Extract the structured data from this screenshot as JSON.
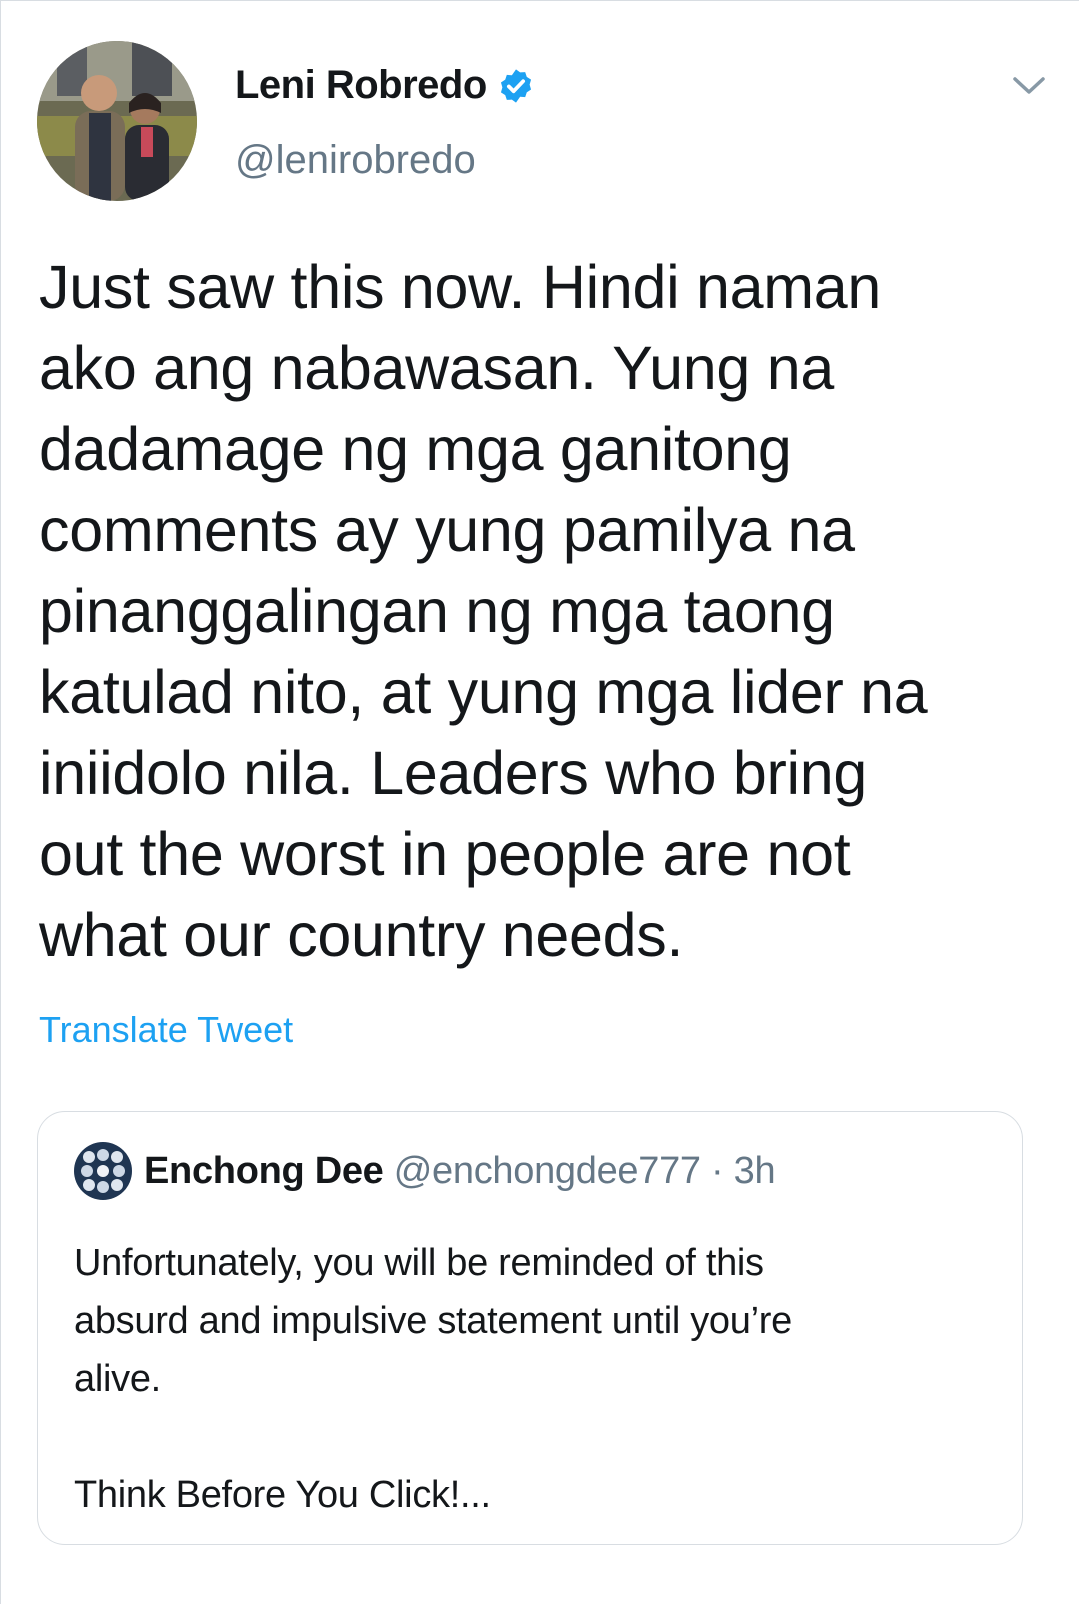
{
  "author": {
    "name": "Leni Robredo",
    "handle": "@lenirobredo",
    "verified": true,
    "avatar": "profile-photo-icon"
  },
  "tweet": {
    "lines": [
      "Just saw this now. Hindi naman",
      "ako ang nabawasan. Yung na",
      "dadamage ng mga ganitong",
      "comments ay yung pamilya na",
      "pinanggalingan ng mga taong",
      "katulad nito,  at yung mga lider na",
      "iniidolo nila. Leaders who bring",
      "out the worst in people are not",
      "what our country needs."
    ],
    "translate_label": "Translate Tweet"
  },
  "quoted": {
    "name": "Enchong Dee",
    "handle": "@enchongdee777",
    "separator": "·",
    "time": "3h",
    "avatar": "profile-photo-icon",
    "lines": [
      "Unfortunately, you will be reminded of this",
      "absurd and impulsive statement until you’re",
      "alive.",
      "",
      "Think Before You Click!..."
    ]
  },
  "colors": {
    "accent": "#1da1f2",
    "text": "#14171a",
    "muted": "#657786",
    "border": "#d8dde2"
  },
  "icons": {
    "verified": "verified-badge-icon",
    "menu": "chevron-down-icon"
  }
}
